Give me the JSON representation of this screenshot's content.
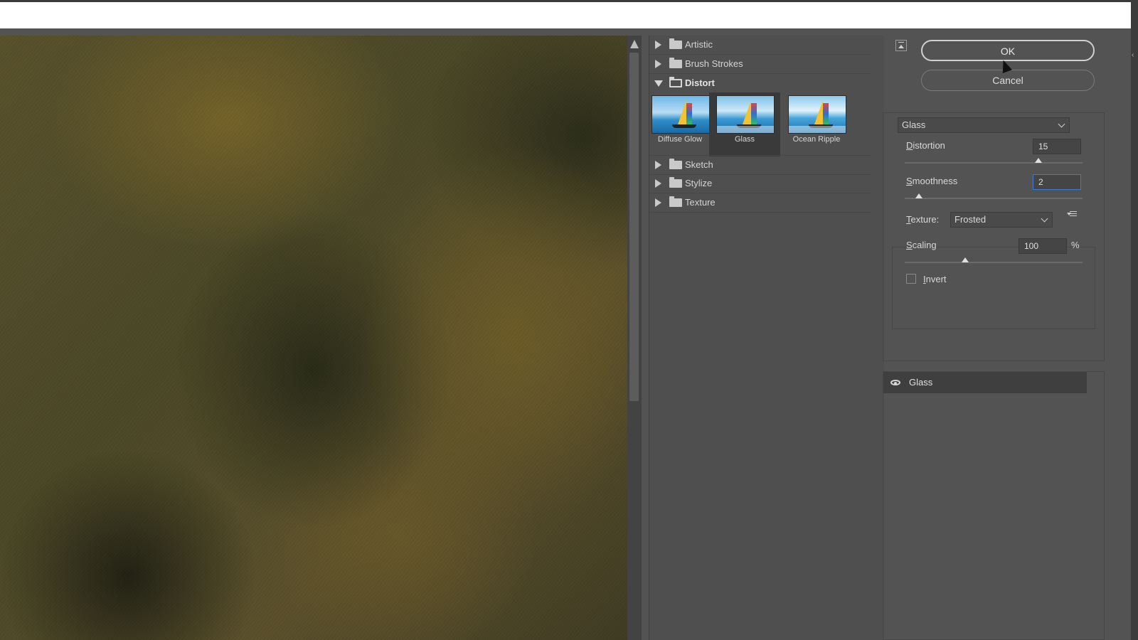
{
  "gallery": {
    "folders_top": [
      {
        "label": "Artistic"
      },
      {
        "label": "Brush Strokes"
      },
      {
        "label": "Distort"
      }
    ],
    "thumbnails": [
      {
        "label": "Diffuse Glow"
      },
      {
        "label": "Glass"
      },
      {
        "label": "Ocean Ripple"
      }
    ],
    "folders_bottom": [
      {
        "label": "Sketch"
      },
      {
        "label": "Stylize"
      },
      {
        "label": "Texture"
      }
    ]
  },
  "dialog": {
    "ok_label": "OK",
    "cancel_label": "Cancel",
    "filter_select": "Glass",
    "distortion": {
      "label_first": "D",
      "label_rest": "istortion",
      "value": "15",
      "slider_fraction": 0.75
    },
    "smoothness": {
      "label_first": "S",
      "label_rest": "moothness",
      "value": "2",
      "slider_fraction": 0.08
    },
    "texture": {
      "label_first": "T",
      "label_rest": "exture:",
      "value": "Frosted"
    },
    "scaling": {
      "label_first": "S",
      "label_rest": "caling",
      "value": "100",
      "unit": "%",
      "slider_fraction": 0.34
    },
    "invert": {
      "label_first": "I",
      "label_rest": "nvert",
      "checked": false
    }
  },
  "layers": {
    "items": [
      {
        "label": "Glass",
        "visible": true
      }
    ]
  }
}
